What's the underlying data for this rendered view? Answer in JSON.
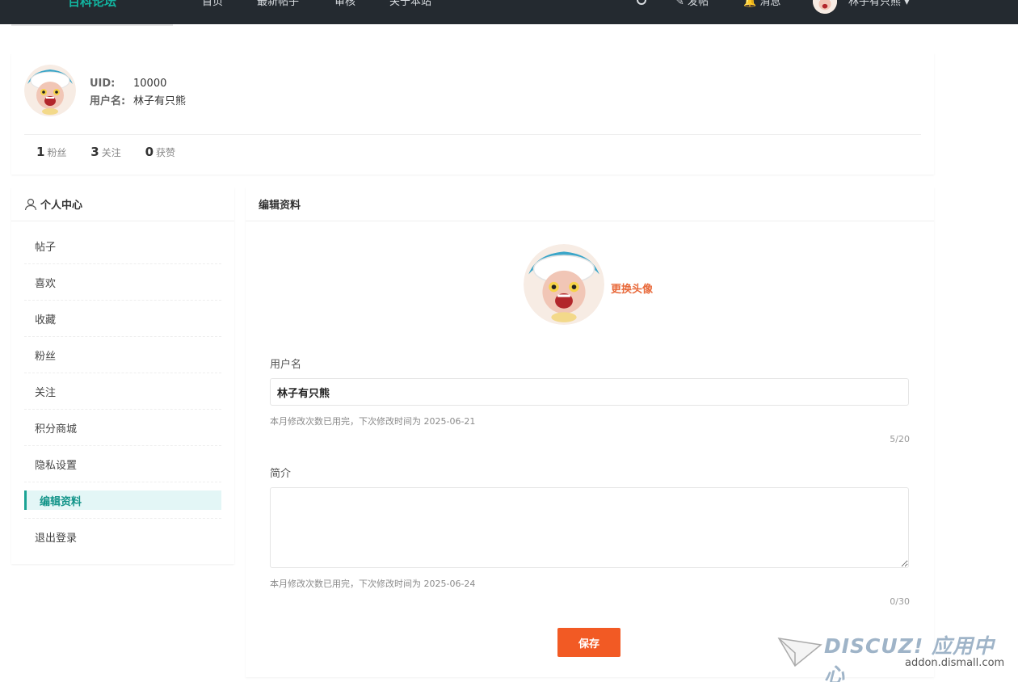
{
  "topbar": {
    "brand": "百科论坛",
    "nav": [
      "首页",
      "最新帖子",
      "审核",
      "关于本站"
    ],
    "post": "发帖",
    "messages": "消息",
    "username": "林子有只熊"
  },
  "profile": {
    "uid_label": "UID:",
    "uid": "10000",
    "username_label": "用户名:",
    "username": "林子有只熊",
    "stats": [
      {
        "num": "1",
        "label": "粉丝"
      },
      {
        "num": "3",
        "label": "关注"
      },
      {
        "num": "0",
        "label": "获赞"
      }
    ]
  },
  "sidebar": {
    "title": "个人中心",
    "items": [
      "帖子",
      "喜欢",
      "收藏",
      "粉丝",
      "关注",
      "积分商城",
      "隐私设置",
      "编辑资料",
      "退出登录"
    ],
    "active_index": 7
  },
  "main": {
    "title": "编辑资料",
    "change_avatar": "更换头像",
    "username_label": "用户名",
    "username_value": "林子有只熊",
    "username_hint": "本月修改次数已用完，下次修改时间为 2025-06-21",
    "username_count": "5/20",
    "bio_label": "简介",
    "bio_value": "",
    "bio_hint": "本月修改次数已用完，下次修改时间为 2025-06-24",
    "bio_count": "0/30",
    "save_label": "保存"
  },
  "watermark": {
    "brand": "DISCUZ! 应用中心",
    "url": "addon.dismall.com"
  }
}
